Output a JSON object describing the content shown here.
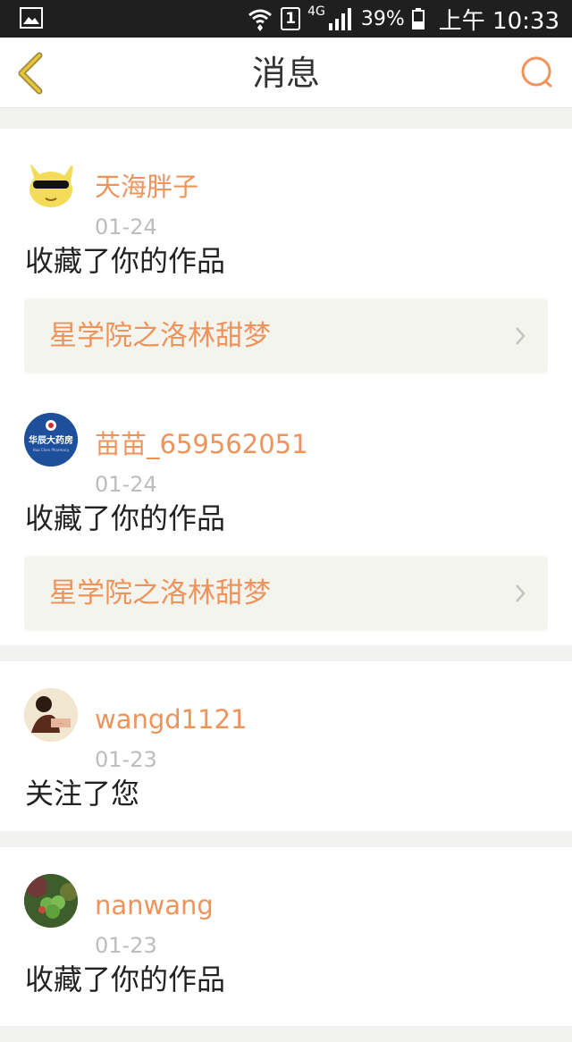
{
  "status_bar": {
    "icons": [
      "image-icon",
      "wifi-icon",
      "sim-icon",
      "signal-icon",
      "battery-icon"
    ],
    "sim_label": "1",
    "network": "4G",
    "battery": "39%",
    "battery_level": 0.39,
    "time": "上午 10:33"
  },
  "header": {
    "title": "消息",
    "back_icon": "chevron-left-icon",
    "search_icon": "search-icon",
    "accent_color": "#f0935a"
  },
  "messages": [
    {
      "username": "天海胖子",
      "date": "01-24",
      "action": "收藏了你的作品",
      "work_title": "星学院之洛林甜梦",
      "avatar_icon": "avatar-pikachu-sunglasses"
    },
    {
      "username": "苗苗_659562051",
      "date": "01-24",
      "action": "收藏了你的作品",
      "work_title": "星学院之洛林甜梦",
      "avatar_icon": "avatar-pharmacy-logo"
    },
    {
      "username": "wangd1121",
      "date": "01-23",
      "action": "关注了您",
      "avatar_icon": "avatar-person-photo"
    },
    {
      "username": "nanwang",
      "date": "01-23",
      "action": "收藏了你的作品",
      "avatar_icon": "avatar-clover-photo"
    }
  ]
}
